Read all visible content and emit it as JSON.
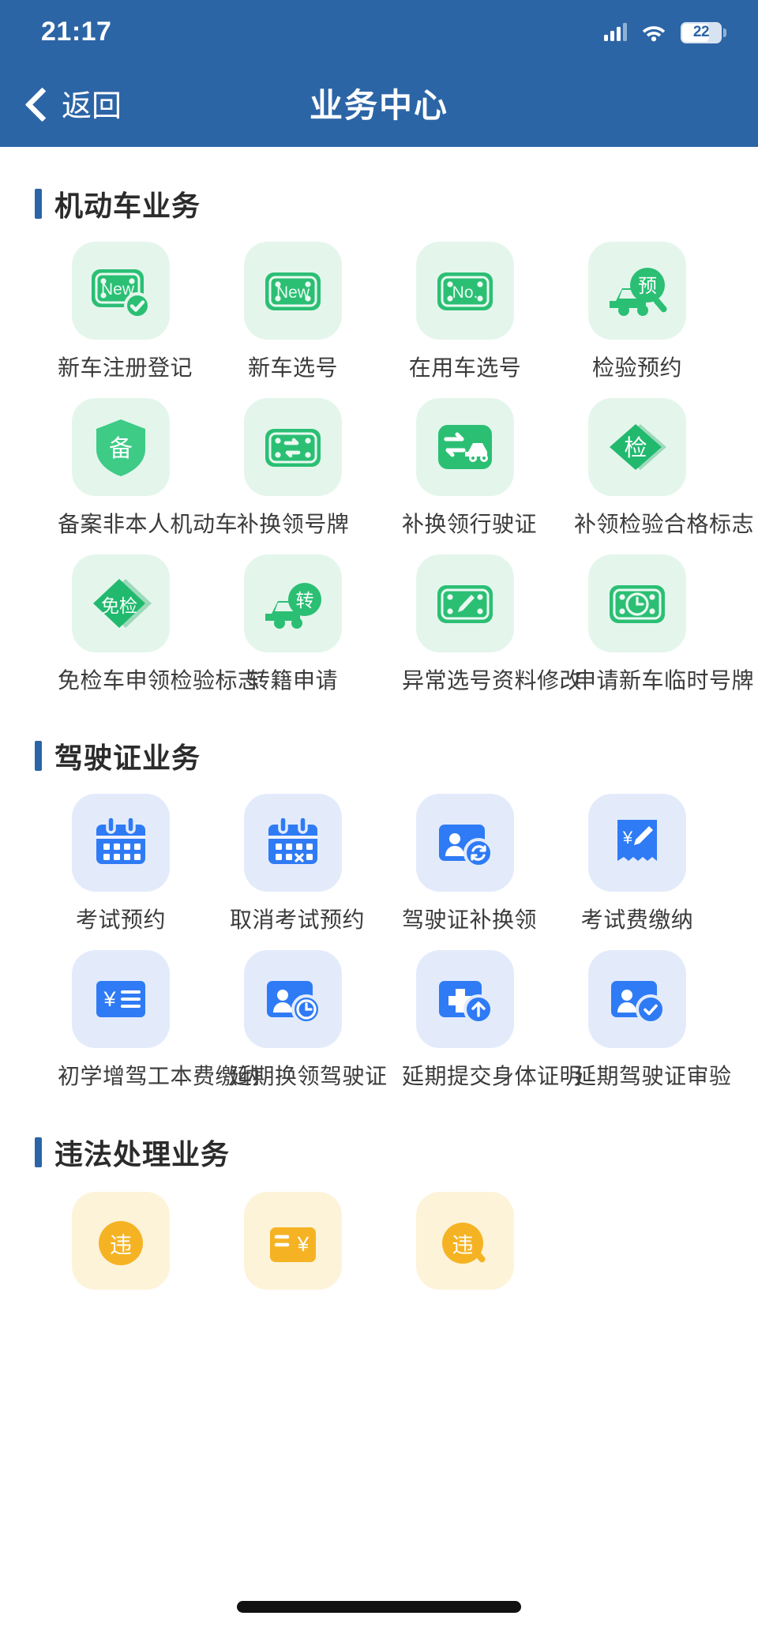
{
  "status_bar": {
    "time": "21:17",
    "signal_icon": "signal-bars-icon",
    "wifi_icon": "wifi-icon",
    "battery_icon": "battery-icon",
    "battery_level": "22"
  },
  "nav": {
    "back_icon": "chevron-left-icon",
    "back_label": "返回",
    "title": "业务中心"
  },
  "colors": {
    "header_blue": "#2C65A6",
    "accent_green": "#2BBF74",
    "accent_blue": "#2F7BF5",
    "accent_yellow": "#F5B324",
    "green_tile_bg": "#E4F6EC",
    "blue_tile_bg": "#E3EBFB",
    "yellow_tile_bg": "#FDF3D9",
    "label_text": "#3B3B3B",
    "title_text": "#2B2B2B"
  },
  "sections": [
    {
      "title": "机动车业务",
      "theme": "green",
      "items": [
        {
          "label": "新车注册登记",
          "icon": "plate-new-check-icon",
          "glyph": "New"
        },
        {
          "label": "新车选号",
          "icon": "plate-new-icon",
          "glyph": "New"
        },
        {
          "label": "在用车选号",
          "icon": "plate-no-icon",
          "glyph": "No."
        },
        {
          "label": "检验预约",
          "icon": "car-magnifier-icon",
          "glyph": "预"
        },
        {
          "label": "备案非本人机动车",
          "icon": "shield-record-icon",
          "glyph": "备"
        },
        {
          "label": "补换领号牌",
          "icon": "plate-swap-icon",
          "glyph": ""
        },
        {
          "label": "补换领行驶证",
          "icon": "swap-car-icon",
          "glyph": ""
        },
        {
          "label": "补领检验合格标志",
          "icon": "diamond-inspect-icon",
          "glyph": "检"
        },
        {
          "label": "免检车申领检验标志",
          "icon": "diamond-exempt-icon",
          "glyph": "免检"
        },
        {
          "label": "转籍申请",
          "icon": "car-transfer-icon",
          "glyph": "转"
        },
        {
          "label": "异常选号资料修改",
          "icon": "plate-edit-icon",
          "glyph": ""
        },
        {
          "label": "申请新车临时号牌",
          "icon": "plate-clock-icon",
          "glyph": ""
        }
      ]
    },
    {
      "title": "驾驶证业务",
      "theme": "blue",
      "items": [
        {
          "label": "考试预约",
          "icon": "calendar-icon",
          "glyph": ""
        },
        {
          "label": "取消考试预约",
          "icon": "calendar-cancel-icon",
          "glyph": "×"
        },
        {
          "label": "驾驶证补换领",
          "icon": "id-card-refresh-icon",
          "glyph": ""
        },
        {
          "label": "考试费缴纳",
          "icon": "receipt-yuan-edit-icon",
          "glyph": "¥"
        },
        {
          "label": "初学增驾工本费缴纳",
          "icon": "yuan-list-icon",
          "glyph": "¥"
        },
        {
          "label": "延期换领驾驶证",
          "icon": "id-card-clock-icon",
          "glyph": ""
        },
        {
          "label": "延期提交身体证明",
          "icon": "medical-upload-icon",
          "glyph": "+"
        },
        {
          "label": "延期驾驶证审验",
          "icon": "id-card-check-icon",
          "glyph": ""
        }
      ]
    },
    {
      "title": "违法处理业务",
      "theme": "yellow",
      "items": [
        {
          "label": "",
          "icon": "violation-circle-icon",
          "glyph": "违"
        },
        {
          "label": "",
          "icon": "violation-fee-icon",
          "glyph": "¥"
        },
        {
          "label": "",
          "icon": "violation-report-icon",
          "glyph": "违"
        }
      ]
    }
  ],
  "home_indicator": "home-indicator-bar"
}
